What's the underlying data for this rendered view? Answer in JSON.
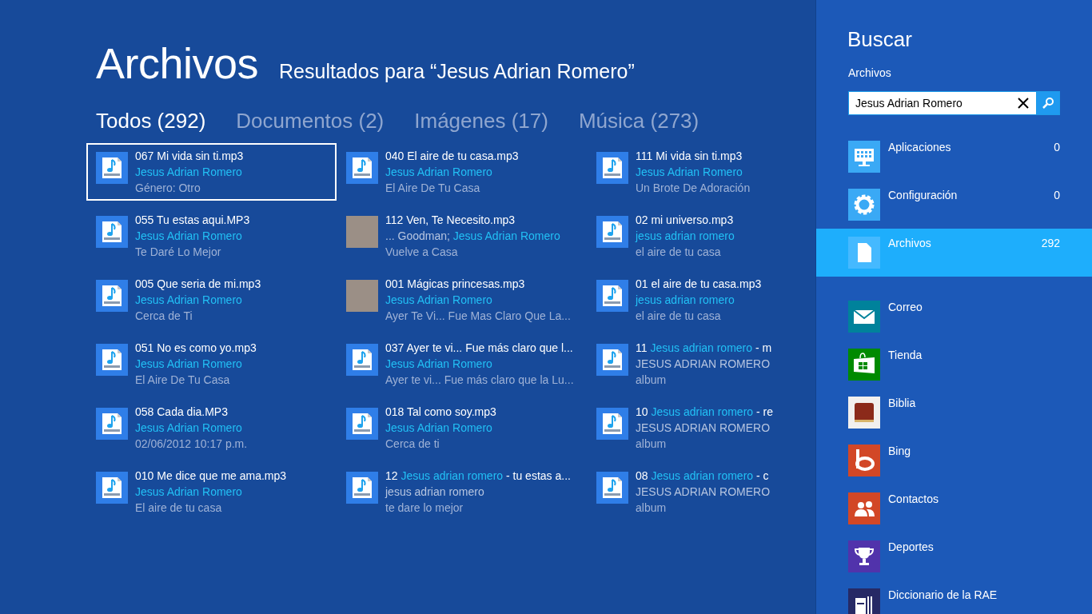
{
  "header": {
    "title": "Archivos",
    "subtitle": "Resultados para “Jesus Adrian Romero”"
  },
  "tabs": [
    {
      "label": "Todos (292)",
      "selected": true
    },
    {
      "label": "Documentos (2)",
      "selected": false
    },
    {
      "label": "Imágenes (17)",
      "selected": false
    },
    {
      "label": "Música (273)",
      "selected": false
    }
  ],
  "result_columns": [
    [
      {
        "kind": "audio",
        "selected": true,
        "title": [
          {
            "text": "067 Mi vida sin ti.mp3",
            "match": false
          }
        ],
        "artist": [
          {
            "text": "Jesus Adrian Romero",
            "match": true
          }
        ],
        "detail": "Género:  Otro"
      },
      {
        "kind": "audio",
        "selected": false,
        "title": [
          {
            "text": "055 Tu estas aqui.MP3",
            "match": false
          }
        ],
        "artist": [
          {
            "text": "Jesus Adrian Romero",
            "match": true
          }
        ],
        "detail": "Te Daré Lo Mejor"
      },
      {
        "kind": "audio",
        "selected": false,
        "title": [
          {
            "text": "005 Que seria de mi.mp3",
            "match": false
          }
        ],
        "artist": [
          {
            "text": "Jesus Adrian Romero",
            "match": true
          }
        ],
        "detail": "Cerca de Ti"
      },
      {
        "kind": "audio",
        "selected": false,
        "title": [
          {
            "text": "051 No es como yo.mp3",
            "match": false
          }
        ],
        "artist": [
          {
            "text": "Jesus Adrian Romero",
            "match": true
          }
        ],
        "detail": "El Aire De Tu Casa"
      },
      {
        "kind": "audio",
        "selected": false,
        "title": [
          {
            "text": "058 Cada dia.MP3",
            "match": false
          }
        ],
        "artist": [
          {
            "text": "Jesus Adrian Romero",
            "match": true
          }
        ],
        "detail": "02/06/2012 10:17 p.m."
      },
      {
        "kind": "audio",
        "selected": false,
        "title": [
          {
            "text": "010 Me dice que me ama.mp3",
            "match": false
          }
        ],
        "artist": [
          {
            "text": "Jesus Adrian Romero",
            "match": true
          }
        ],
        "detail": "El aire de tu casa"
      }
    ],
    [
      {
        "kind": "audio",
        "selected": false,
        "title": [
          {
            "text": "040 El aire de tu casa.mp3",
            "match": false
          }
        ],
        "artist": [
          {
            "text": "Jesus Adrian Romero",
            "match": true
          }
        ],
        "detail": "El Aire De Tu Casa"
      },
      {
        "kind": "cover",
        "selected": false,
        "title": [
          {
            "text": "112 Ven, Te Necesito.mp3",
            "match": false
          }
        ],
        "artist": [
          {
            "text": "... Goodman; ",
            "match": false
          },
          {
            "text": "Jesus Adrian Romero",
            "match": true
          }
        ],
        "detail": "Vuelve a Casa"
      },
      {
        "kind": "cover",
        "selected": false,
        "title": [
          {
            "text": "001 Mágicas princesas.mp3",
            "match": false
          }
        ],
        "artist": [
          {
            "text": "Jesus Adrian Romero",
            "match": true
          }
        ],
        "detail": "Ayer Te Vi... Fue Mas Claro Que La..."
      },
      {
        "kind": "audio",
        "selected": false,
        "title": [
          {
            "text": "037 Ayer te vi... Fue más claro que l...",
            "match": false
          }
        ],
        "artist": [
          {
            "text": "Jesus Adrian Romero",
            "match": true
          }
        ],
        "detail": "Ayer te vi... Fue más claro que la Lu..."
      },
      {
        "kind": "audio",
        "selected": false,
        "title": [
          {
            "text": "018 Tal como soy.mp3",
            "match": false
          }
        ],
        "artist": [
          {
            "text": "Jesus Adrian Romero",
            "match": true
          }
        ],
        "detail": "Cerca de ti"
      },
      {
        "kind": "audio",
        "selected": false,
        "title": [
          {
            "text": "12 ",
            "match": false
          },
          {
            "text": "Jesus adrian romero",
            "match": true
          },
          {
            "text": " - tu estas a...",
            "match": false
          }
        ],
        "artist": [
          {
            "text": "jesus adrian romero",
            "match": false
          }
        ],
        "detail": "te dare lo mejor"
      }
    ],
    [
      {
        "kind": "audio",
        "selected": false,
        "title": [
          {
            "text": "111 Mi vida sin ti.mp3",
            "match": false
          }
        ],
        "artist": [
          {
            "text": "Jesus Adrian Romero",
            "match": true
          }
        ],
        "detail": "Un Brote De Adoración"
      },
      {
        "kind": "audio",
        "selected": false,
        "title": [
          {
            "text": "02 mi universo.mp3",
            "match": false
          }
        ],
        "artist": [
          {
            "text": "jesus adrian romero",
            "match": true
          }
        ],
        "detail": "el aire de tu casa"
      },
      {
        "kind": "audio",
        "selected": false,
        "title": [
          {
            "text": "01 el aire de tu casa.mp3",
            "match": false
          }
        ],
        "artist": [
          {
            "text": "jesus adrian romero",
            "match": true
          }
        ],
        "detail": "el aire de tu casa"
      },
      {
        "kind": "audio",
        "selected": false,
        "title": [
          {
            "text": "11 ",
            "match": false
          },
          {
            "text": "Jesus adrian romero",
            "match": true
          },
          {
            "text": " - m",
            "match": false
          }
        ],
        "artist": [
          {
            "text": "JESUS ADRIAN ROMERO",
            "match": false
          }
        ],
        "detail": "album"
      },
      {
        "kind": "audio",
        "selected": false,
        "title": [
          {
            "text": "10 ",
            "match": false
          },
          {
            "text": "Jesus adrian romero",
            "match": true
          },
          {
            "text": " - re",
            "match": false
          }
        ],
        "artist": [
          {
            "text": "JESUS ADRIAN ROMERO",
            "match": false
          }
        ],
        "detail": "album"
      },
      {
        "kind": "audio",
        "selected": false,
        "title": [
          {
            "text": "08 ",
            "match": false
          },
          {
            "text": "Jesus adrian romero",
            "match": true
          },
          {
            "text": " - c",
            "match": false
          }
        ],
        "artist": [
          {
            "text": "JESUS ADRIAN ROMERO",
            "match": false
          }
        ],
        "detail": "album"
      }
    ]
  ],
  "search_pane": {
    "title": "Buscar",
    "scope": "Archivos",
    "search": {
      "value": "Jesus Adrian Romero"
    },
    "categories": [
      {
        "kind": "apps",
        "label": "Aplicaciones",
        "count": "0",
        "selected": false
      },
      {
        "kind": "settings",
        "label": "Configuración",
        "count": "0",
        "selected": false
      },
      {
        "kind": "files",
        "label": "Archivos",
        "count": "292",
        "selected": true
      }
    ],
    "apps": [
      {
        "kind": "mail",
        "label": "Correo"
      },
      {
        "kind": "store",
        "label": "Tienda"
      },
      {
        "kind": "bible",
        "label": "Biblia"
      },
      {
        "kind": "bing",
        "label": "Bing"
      },
      {
        "kind": "people",
        "label": "Contactos"
      },
      {
        "kind": "sports",
        "label": "Deportes"
      },
      {
        "kind": "dictionary",
        "label": "Diccionario de la RAE"
      }
    ]
  }
}
